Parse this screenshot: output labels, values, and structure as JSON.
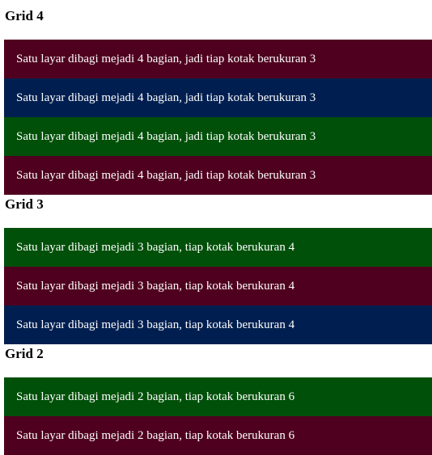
{
  "colors": {
    "maroon": "#4f001e",
    "navy": "#001f50",
    "green": "#005009"
  },
  "sections": [
    {
      "heading": "Grid 4",
      "items": [
        {
          "text": "Satu layar dibagi mejadi 4 bagian, jadi tiap kotak berukuran 3",
          "color": "maroon"
        },
        {
          "text": "Satu layar dibagi mejadi 4 bagian, jadi tiap kotak berukuran 3",
          "color": "navy"
        },
        {
          "text": "Satu layar dibagi mejadi 4 bagian, jadi tiap kotak berukuran 3",
          "color": "green"
        },
        {
          "text": "Satu layar dibagi mejadi 4 bagian, jadi tiap kotak berukuran 3",
          "color": "maroon"
        }
      ]
    },
    {
      "heading": "Grid 3",
      "items": [
        {
          "text": "Satu layar dibagi mejadi 3 bagian, tiap kotak berukuran 4",
          "color": "green"
        },
        {
          "text": "Satu layar dibagi mejadi 3 bagian, tiap kotak berukuran 4",
          "color": "maroon"
        },
        {
          "text": "Satu layar dibagi mejadi 3 bagian, tiap kotak berukuran 4",
          "color": "navy"
        }
      ]
    },
    {
      "heading": "Grid 2",
      "items": [
        {
          "text": "Satu layar dibagi mejadi 2 bagian, tiap kotak berukuran 6",
          "color": "green"
        },
        {
          "text": "Satu layar dibagi mejadi 2 bagian, tiap kotak berukuran 6",
          "color": "maroon"
        }
      ]
    }
  ]
}
